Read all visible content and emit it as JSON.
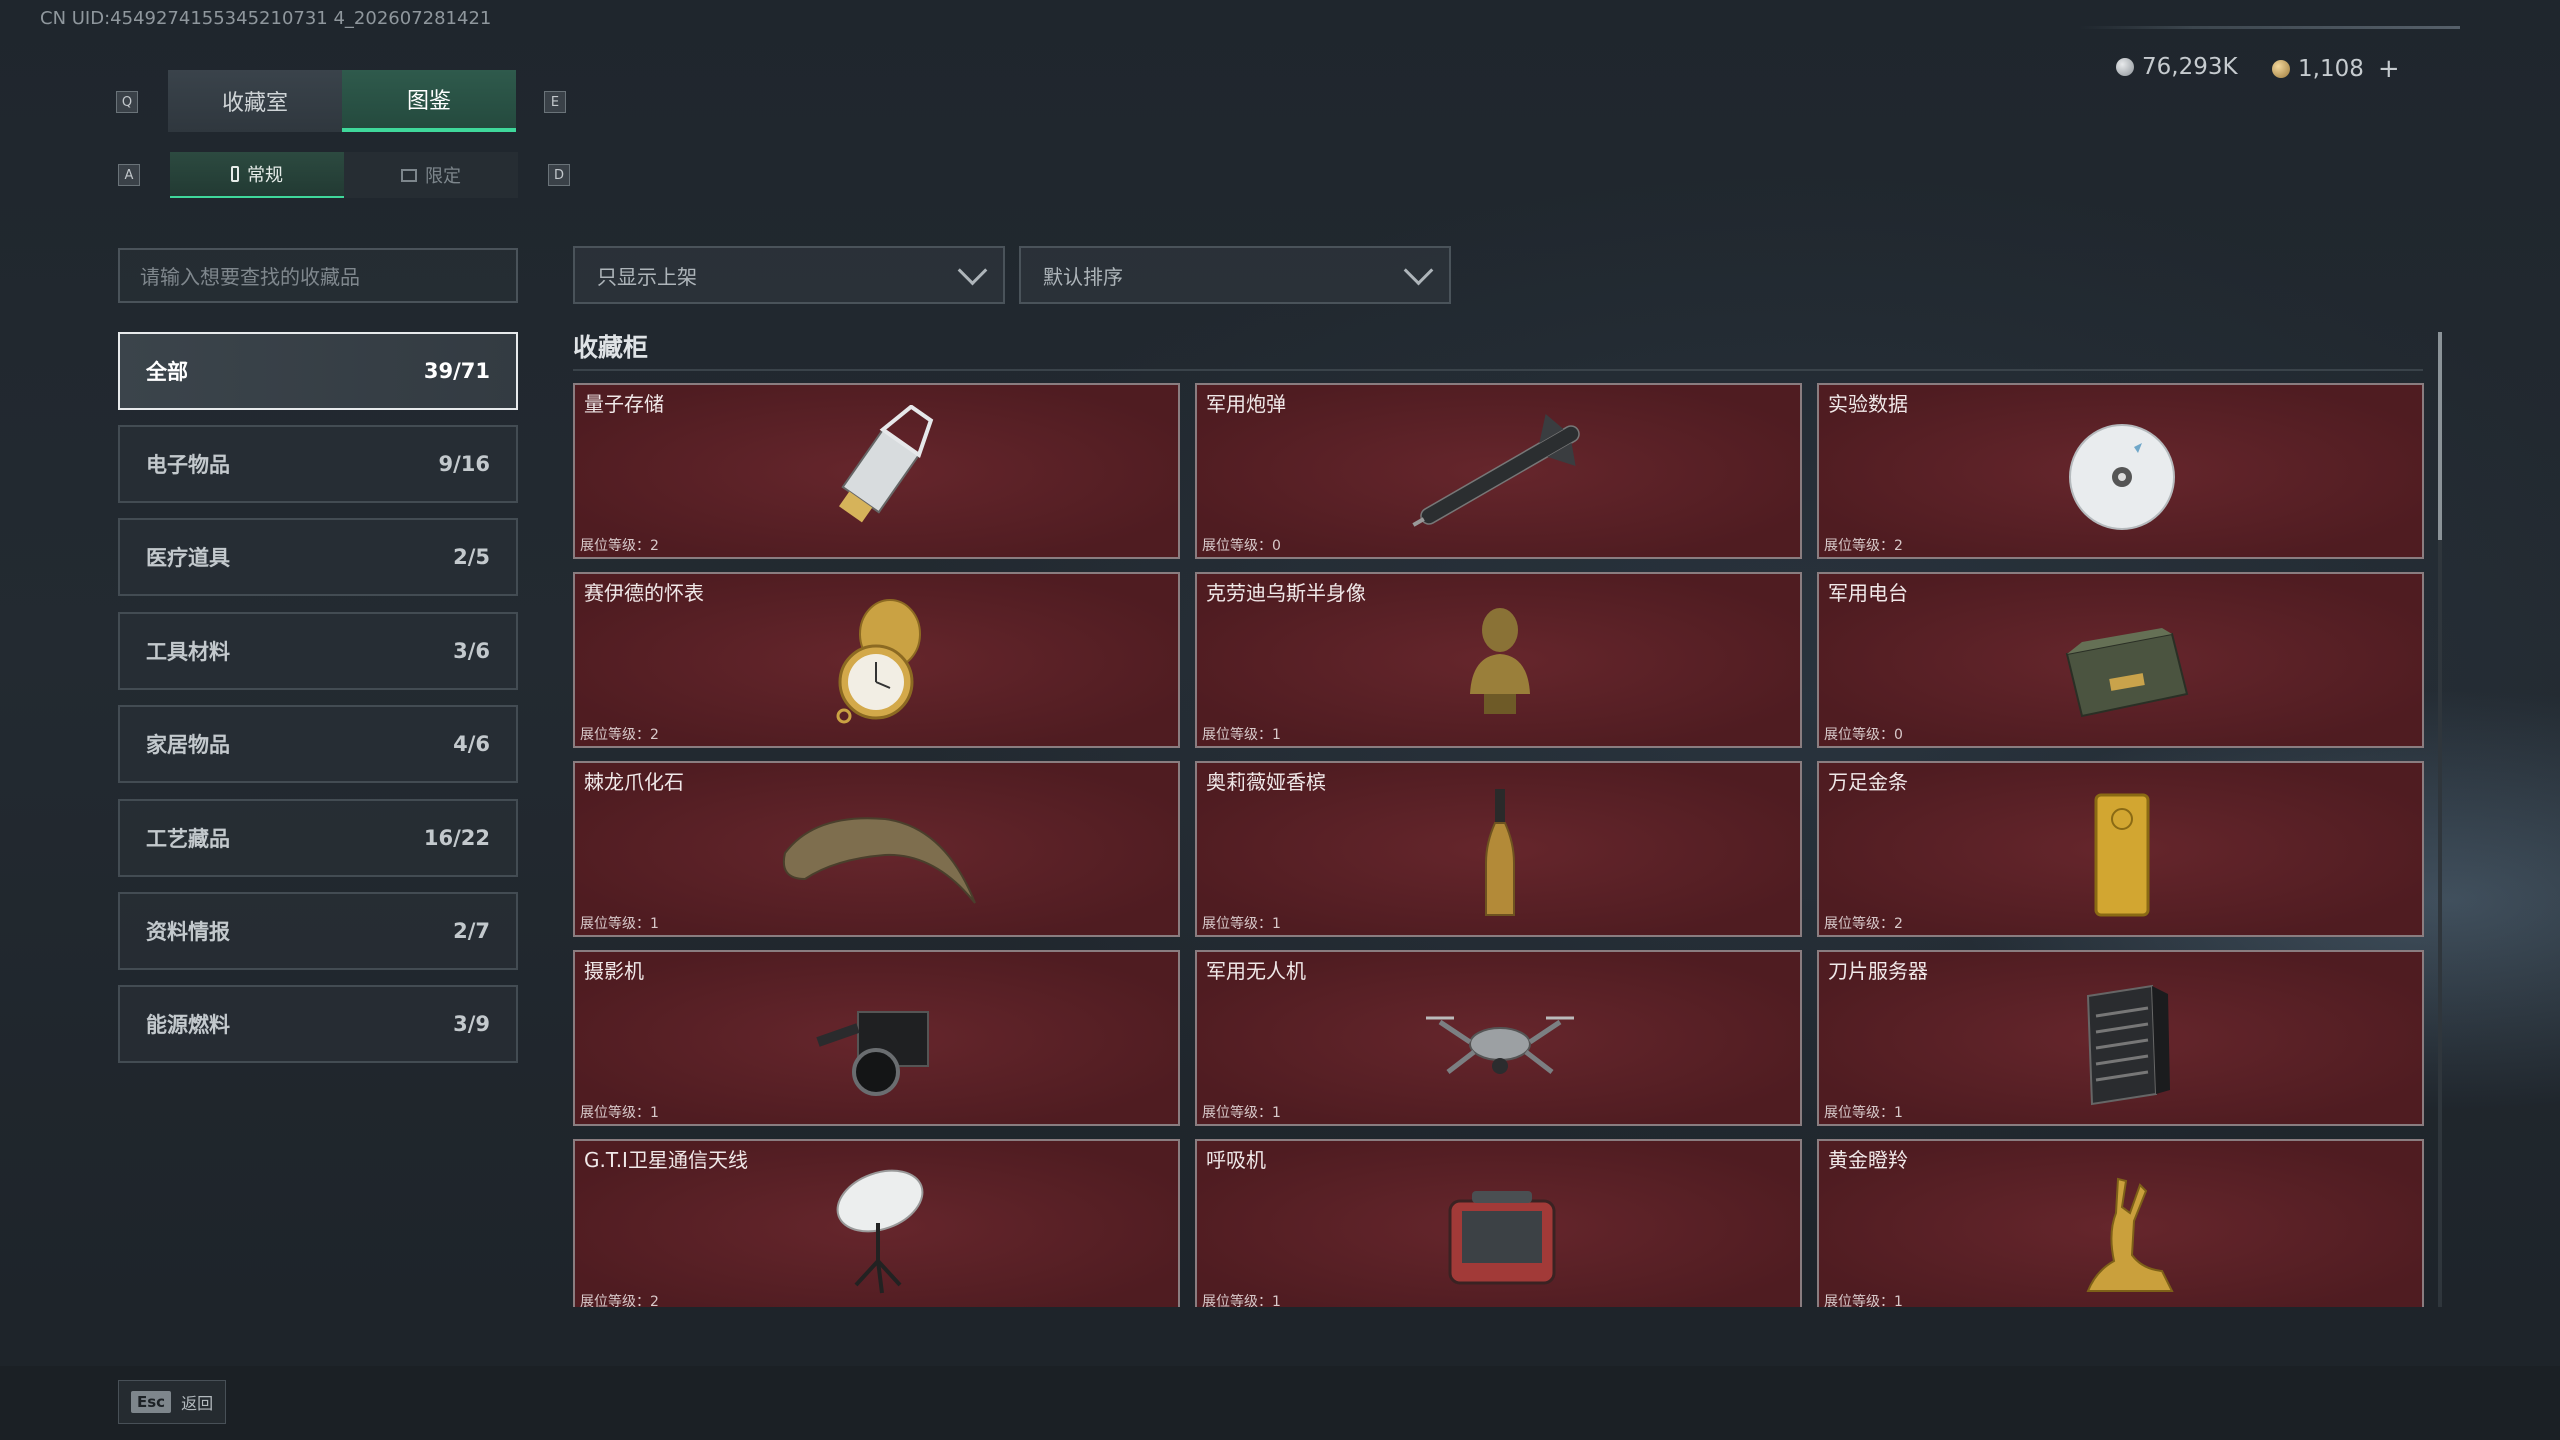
{
  "uid": "CN UID:4549274155345210731 4_202607281421",
  "currency": {
    "silver": "76,293K",
    "gold": "1,108",
    "add_label": "+"
  },
  "tabs": {
    "key_left": "Q",
    "key_right": "E",
    "items": [
      {
        "label": "收藏室"
      },
      {
        "label": "图鉴"
      }
    ]
  },
  "subtabs": {
    "key_left": "A",
    "key_right": "D",
    "items": [
      {
        "label": "常规"
      },
      {
        "label": "限定"
      }
    ]
  },
  "search": {
    "placeholder": "请输入想要查找的收藏品"
  },
  "filters": {
    "display": "只显示上架",
    "sort": "默认排序"
  },
  "categories": [
    {
      "label": "全部",
      "count": "39/71"
    },
    {
      "label": "电子物品",
      "count": "9/16"
    },
    {
      "label": "医疗道具",
      "count": "2/5"
    },
    {
      "label": "工具材料",
      "count": "3/6"
    },
    {
      "label": "家居物品",
      "count": "4/6"
    },
    {
      "label": "工艺藏品",
      "count": "16/22"
    },
    {
      "label": "资料情报",
      "count": "2/7"
    },
    {
      "label": "能源燃料",
      "count": "3/9"
    }
  ],
  "section_title": "收藏柜",
  "items": [
    {
      "name": "量子存储",
      "level": "展位等级：2",
      "icon": "usb-drive-icon"
    },
    {
      "name": "军用炮弹",
      "level": "展位等级：0",
      "icon": "missile-icon"
    },
    {
      "name": "实验数据",
      "level": "展位等级：2",
      "icon": "disc-icon"
    },
    {
      "name": "赛伊德的怀表",
      "level": "展位等级：2",
      "icon": "pocket-watch-icon"
    },
    {
      "name": "克劳迪乌斯半身像",
      "level": "展位等级：1",
      "icon": "bust-statue-icon"
    },
    {
      "name": "军用电台",
      "level": "展位等级：0",
      "icon": "military-radio-icon"
    },
    {
      "name": "棘龙爪化石",
      "level": "展位等级：1",
      "icon": "claw-fossil-icon"
    },
    {
      "name": "奥莉薇娅香槟",
      "level": "展位等级：1",
      "icon": "champagne-bottle-icon"
    },
    {
      "name": "万足金条",
      "level": "展位等级：2",
      "icon": "gold-bar-icon"
    },
    {
      "name": "摄影机",
      "level": "展位等级：1",
      "icon": "video-camera-icon"
    },
    {
      "name": "军用无人机",
      "level": "展位等级：1",
      "icon": "drone-icon"
    },
    {
      "name": "刀片服务器",
      "level": "展位等级：1",
      "icon": "blade-server-icon"
    },
    {
      "name": "G.T.I卫星通信天线",
      "level": "展位等级：2",
      "icon": "satellite-dish-icon"
    },
    {
      "name": "呼吸机",
      "level": "展位等级：1",
      "icon": "ventilator-icon"
    },
    {
      "name": "黄金瞪羚",
      "level": "展位等级：1",
      "icon": "golden-gazelle-icon"
    }
  ],
  "footer": {
    "esc_key": "Esc",
    "esc_label": "返回"
  },
  "colors": {
    "accent": "#3fd89b",
    "card_bg": "#5c2126",
    "card_border": "#8a7d80"
  }
}
